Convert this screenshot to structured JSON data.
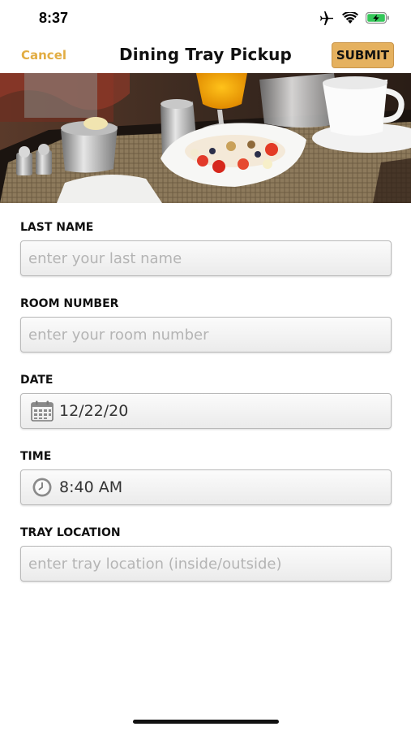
{
  "status_bar": {
    "time": "8:37",
    "icons": [
      "airplane-icon",
      "wifi-icon",
      "battery-charging-icon"
    ],
    "battery_color": "#34c759"
  },
  "nav": {
    "cancel_label": "Cancel",
    "title": "Dining Tray Pickup",
    "submit_label": "SUBMIT",
    "accent_color": "#e2ad43"
  },
  "hero": {
    "image": "room-service breakfast tray photo"
  },
  "form": {
    "last_name": {
      "label": "LAST NAME",
      "placeholder": "enter your last name",
      "value": ""
    },
    "room_number": {
      "label": "ROOM NUMBER",
      "placeholder": "enter your room number",
      "value": ""
    },
    "date": {
      "label": "DATE",
      "icon": "calendar-icon",
      "value": "12/22/20"
    },
    "time": {
      "label": "TIME",
      "icon": "clock-icon",
      "value": "8:40 AM"
    },
    "tray_location": {
      "label": "TRAY LOCATION",
      "placeholder": "enter tray location (inside/outside)",
      "value": ""
    }
  }
}
